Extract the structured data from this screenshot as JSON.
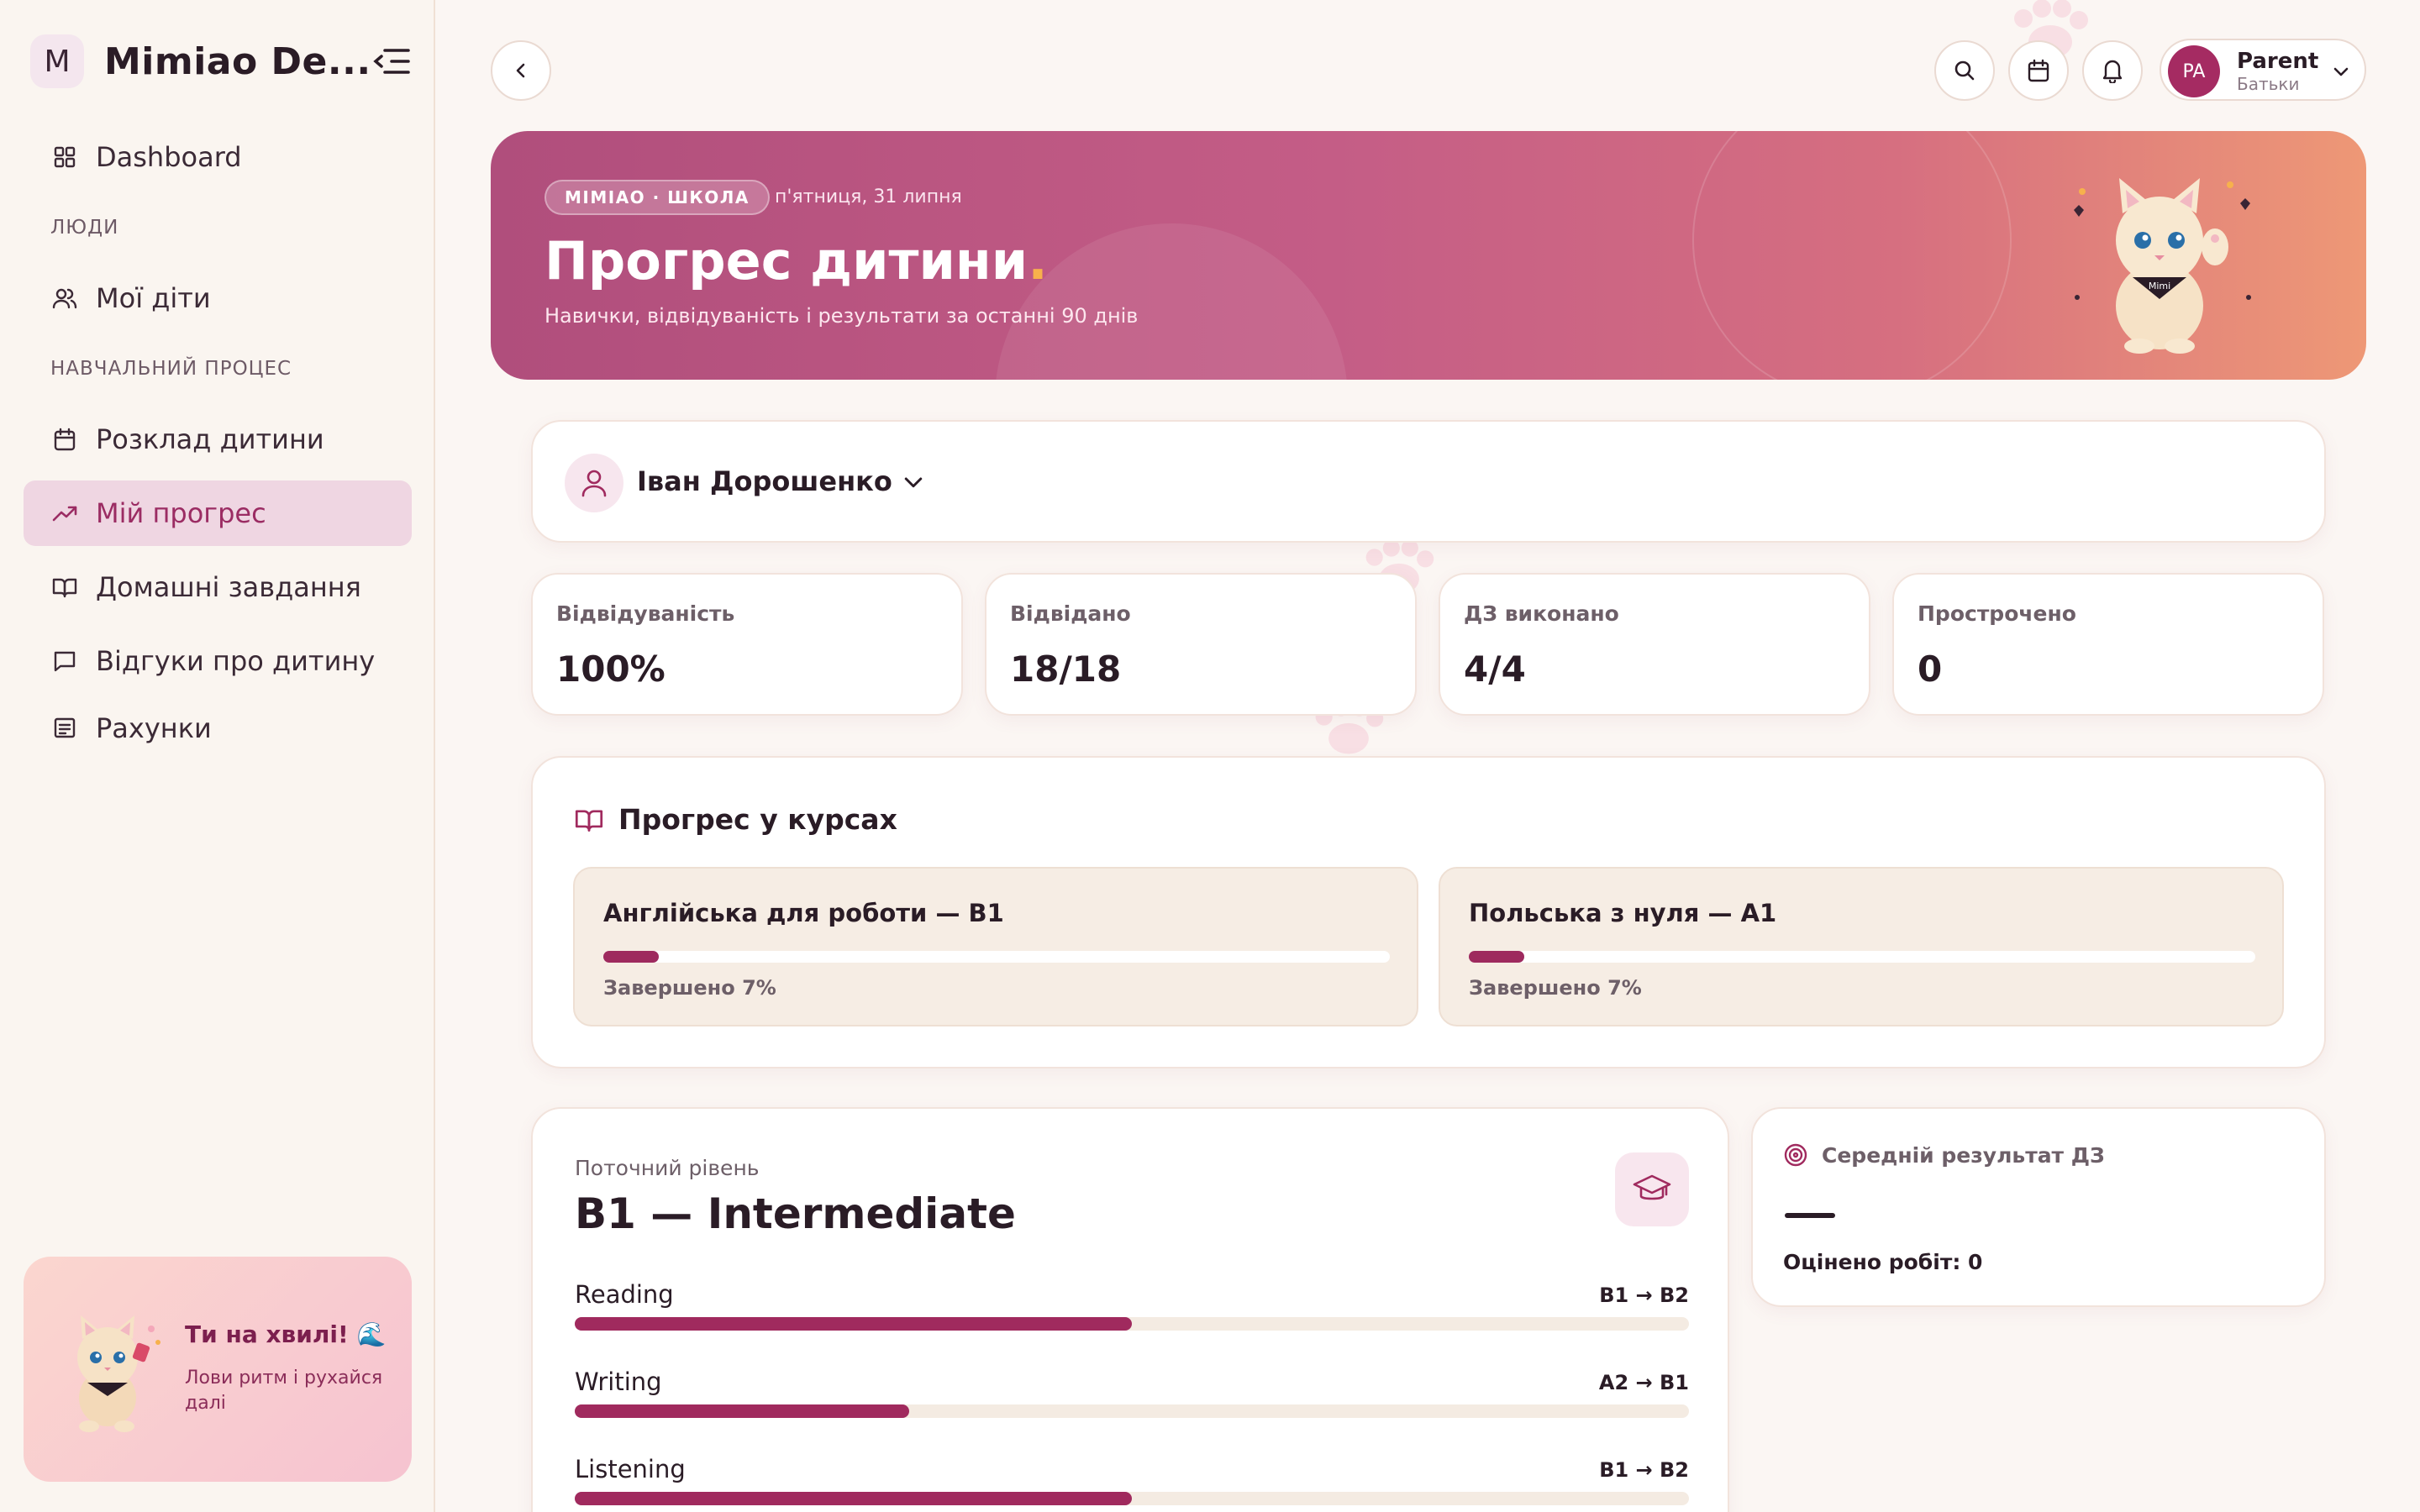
{
  "sidebar": {
    "brand_initial": "M",
    "brand_name": "Mimiao De...",
    "items": {
      "dashboard": "Dashboard",
      "section_people": "ЛЮДИ",
      "my_children": "Мої діти",
      "section_learning": "НАВЧАЛЬНИЙ ПРОЦЕС",
      "schedule": "Розклад дитини",
      "progress": "Мій прогрес",
      "homework": "Домашні завдання",
      "feedback": "Відгуки про дитину",
      "invoices": "Рахунки"
    },
    "active_item": "progress",
    "promo": {
      "title": "Ти на хвилі! 🌊",
      "text": "Лови ритм і рухайся далі"
    }
  },
  "header": {
    "user": {
      "initials": "PA",
      "name": "Parent",
      "role": "Батьки"
    }
  },
  "hero": {
    "badge": "MIMIAO · ШКОЛА",
    "date": "п'ятниця, 31 липня",
    "title": "Прогрес дитини",
    "title_dot": ".",
    "subtitle": "Навички, відвідуваність і результати за останні 90 днів",
    "mascot_label": "Mimi"
  },
  "child_selector": {
    "name": "Іван Дорошенко"
  },
  "stats": [
    {
      "label": "Відвідуваність",
      "value": "100%"
    },
    {
      "label": "Відвідано",
      "value": "18/18"
    },
    {
      "label": "ДЗ виконано",
      "value": "4/4"
    },
    {
      "label": "Прострочено",
      "value": "0"
    }
  ],
  "courses": {
    "title": "Прогрес у курсах",
    "items": [
      {
        "title": "Англійська для роботи — B1",
        "progress": 0.07,
        "done_label": "Завершено 7%"
      },
      {
        "title": "Польська з нуля — A1",
        "progress": 0.07,
        "done_label": "Завершено 7%"
      }
    ]
  },
  "level": {
    "label": "Поточний рівень",
    "value": "B1 — Intermediate",
    "skills": [
      {
        "name": "Reading",
        "range": "B1 → B2",
        "progress": 0.5
      },
      {
        "name": "Writing",
        "range": "A2 → B1",
        "progress": 0.3
      },
      {
        "name": "Listening",
        "range": "B1 → B2",
        "progress": 0.5
      }
    ]
  },
  "homework_result": {
    "title": "Середній результат ДЗ",
    "value": "—",
    "count_label": "Оцінено робіт: 0"
  },
  "colors": {
    "accent": "#9e2a5e",
    "active_nav_bg": "#efd6e2",
    "hero_start": "#b04e7c",
    "hero_end": "#ee9876"
  },
  "icons": [
    "grid-icon",
    "users-icon",
    "calendar-icon",
    "trending-up-icon",
    "book-open-icon",
    "message-icon",
    "receipt-icon",
    "search-icon",
    "bell-icon",
    "chevron-down-icon",
    "chevron-left-icon",
    "graduation-cap-icon",
    "target-icon",
    "user-icon"
  ]
}
